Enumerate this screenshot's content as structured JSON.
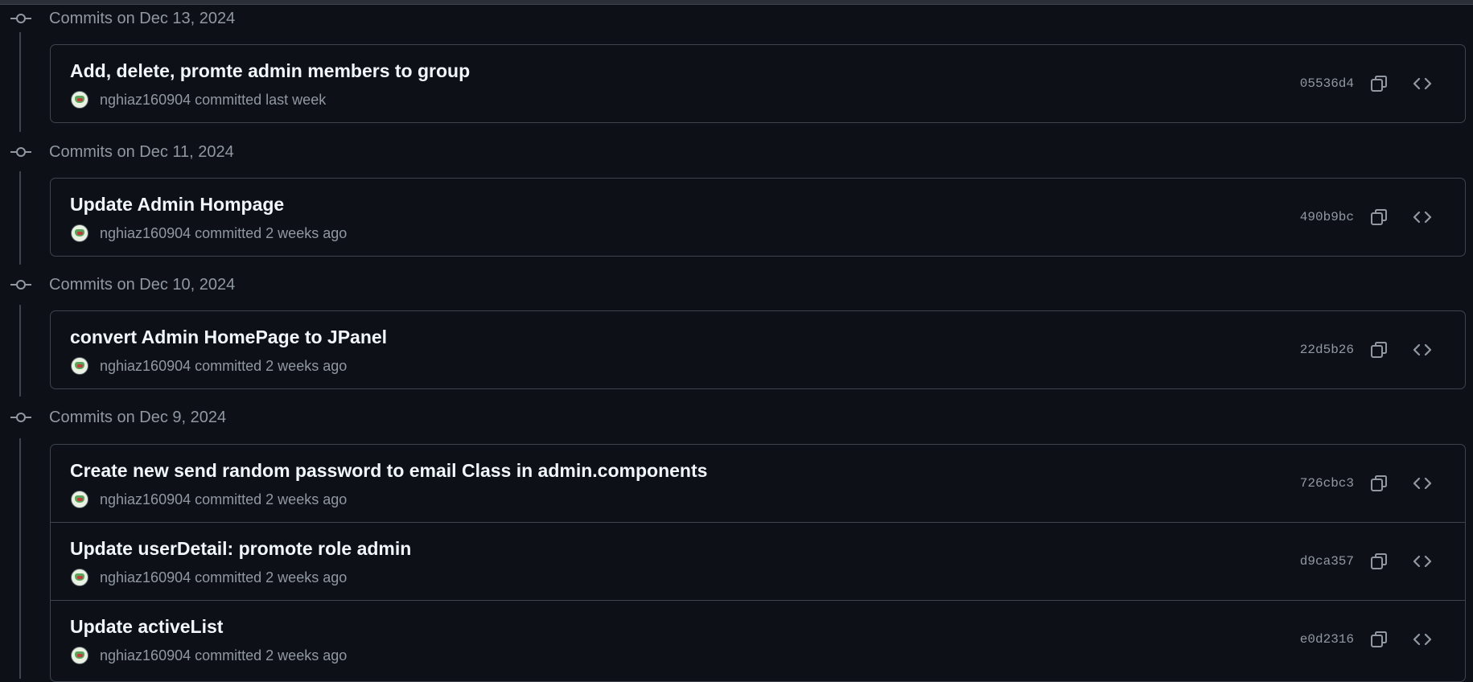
{
  "groups": [
    {
      "title": "Commits on Dec 13, 2024",
      "commits": [
        {
          "message": "Add, delete, promte admin members to group",
          "author": "nghiaz160904",
          "verb": "committed",
          "time": "last week",
          "sha": "05536d4"
        }
      ]
    },
    {
      "title": "Commits on Dec 11, 2024",
      "commits": [
        {
          "message": "Update Admin Hompage",
          "author": "nghiaz160904",
          "verb": "committed",
          "time": "2 weeks ago",
          "sha": "490b9bc"
        }
      ]
    },
    {
      "title": "Commits on Dec 10, 2024",
      "commits": [
        {
          "message": "convert Admin HomePage to JPanel",
          "author": "nghiaz160904",
          "verb": "committed",
          "time": "2 weeks ago",
          "sha": "22d5b26"
        }
      ]
    },
    {
      "title": "Commits on Dec 9, 2024",
      "commits": [
        {
          "message": "Create new send random password to email Class in admin.components",
          "author": "nghiaz160904",
          "verb": "committed",
          "time": "2 weeks ago",
          "sha": "726cbc3"
        },
        {
          "message": "Update userDetail: promote role admin",
          "author": "nghiaz160904",
          "verb": "committed",
          "time": "2 weeks ago",
          "sha": "d9ca357"
        },
        {
          "message": "Update activeList",
          "author": "nghiaz160904",
          "verb": "committed",
          "time": "2 weeks ago",
          "sha": "e0d2316"
        }
      ]
    }
  ],
  "icons": {
    "commit": "git-commit-icon",
    "copy": "copy-icon",
    "browse": "code-icon",
    "avatar": "avatar"
  },
  "colors": {
    "background": "#0d1117",
    "border": "#3d444d",
    "text_primary": "#f0f6fc",
    "text_muted": "#9198a1"
  }
}
